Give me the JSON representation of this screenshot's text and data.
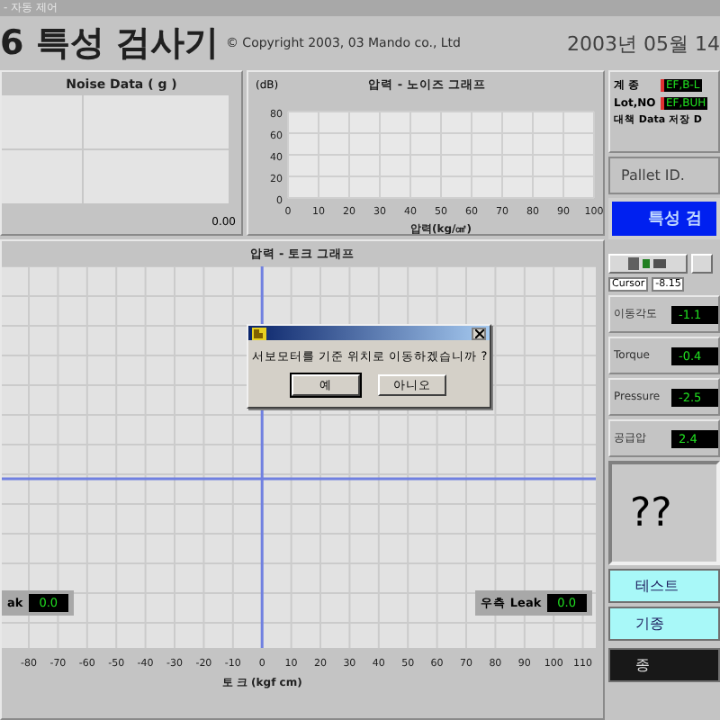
{
  "window": {
    "title": "- 자동 제어"
  },
  "header": {
    "title": "6 특성 검사기",
    "copyright": "© Copyright 2003, 03  Mando co., Ltd",
    "date": "2003년 05월 14"
  },
  "noise_panel": {
    "title": "Noise Data ( g )",
    "value": "0.00"
  },
  "pressure_noise_chart": {
    "unit": "(dB)",
    "chart_data": {
      "type": "line",
      "title": "압력 - 노이즈 그래프",
      "xlabel": "압력(kg/㎠)",
      "xlim": [
        0,
        100
      ],
      "ylim": [
        0,
        80
      ],
      "grid": true,
      "xticks": [
        0,
        10,
        20,
        30,
        40,
        50,
        60,
        70,
        80,
        90,
        100
      ],
      "yticks": [
        0,
        20,
        40,
        60,
        80
      ]
    }
  },
  "info_panel": {
    "fields": [
      {
        "label": "계   종",
        "value": "EF,B-L"
      },
      {
        "label": "Lot,NO",
        "value": "EF,BUH"
      }
    ],
    "note": "대책 Data 저장 D"
  },
  "pallet": {
    "label": "Pallet ID."
  },
  "status_banner": {
    "text": "특성 검"
  },
  "pressure_torque_chart": {
    "title": "압력 - 토크 그래프",
    "grid": true,
    "x_axis": {
      "label": "토  크 (kgf cm)",
      "ticks": [
        "-80",
        "-70",
        "-60",
        "-50",
        "-40",
        "-30",
        "-20",
        "-10",
        "0",
        "10",
        "20",
        "30",
        "40",
        "50",
        "60",
        "70",
        "80",
        "90",
        "100",
        "110"
      ]
    },
    "leaks": [
      {
        "label": "ak",
        "value": "0.0"
      },
      {
        "label": "우측 Leak",
        "value": "0.0"
      }
    ]
  },
  "dialog": {
    "message": "서보모터를 기준 위치로 이동하겠습니까 ?",
    "buttons": [
      {
        "label": "예",
        "selected": true
      },
      {
        "label": "아니오",
        "selected": false
      }
    ]
  },
  "cursor": {
    "label": "Cursor",
    "value": "-8.15"
  },
  "readings": [
    {
      "label": "이동각도",
      "value": "-1.1"
    },
    {
      "label": "Torque",
      "value": "-0.4"
    },
    {
      "label": "Pressure",
      "value": "-2.5"
    },
    {
      "label": "공급압",
      "value": "2.4"
    }
  ],
  "result": {
    "text": "??"
  },
  "buttons": [
    {
      "label": "테스트",
      "kind": "light"
    },
    {
      "label": "기종",
      "kind": "light"
    },
    {
      "label": "종",
      "kind": "dark"
    }
  ]
}
